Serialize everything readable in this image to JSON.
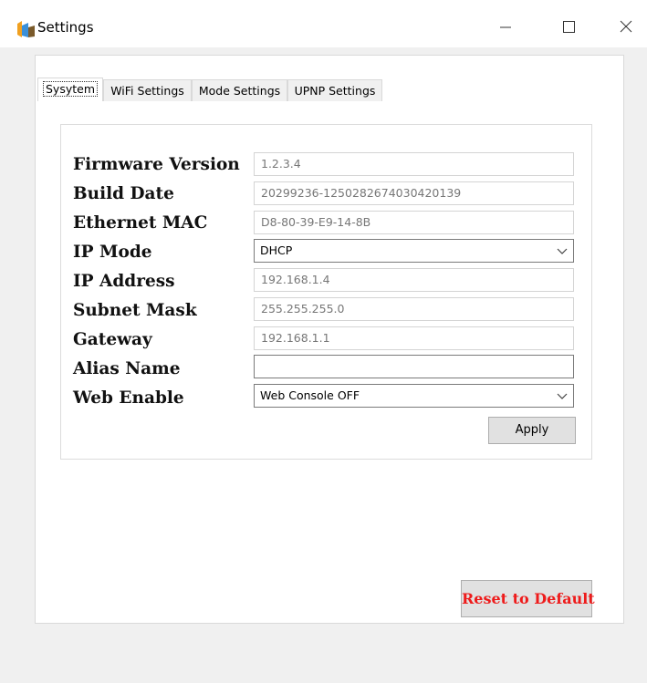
{
  "window": {
    "title": "Settings",
    "app_icon": "settings-app-icon",
    "controls": [
      "minimize-icon",
      "maximize-icon",
      "close-icon"
    ]
  },
  "tabs": [
    {
      "label": "Sysytem",
      "active": true
    },
    {
      "label": "WiFi Settings",
      "active": false
    },
    {
      "label": "Mode Settings",
      "active": false
    },
    {
      "label": "UPNP Settings",
      "active": false
    }
  ],
  "system": {
    "firmware_version": {
      "label": "Firmware Version",
      "value": "1.2.3.4"
    },
    "build_date": {
      "label": "Build Date",
      "value": "20299236-1250282674030420139"
    },
    "ethernet_mac": {
      "label": "Ethernet MAC",
      "value": "D8-80-39-E9-14-8B"
    },
    "ip_mode": {
      "label": "IP Mode",
      "value": "DHCP"
    },
    "ip_address": {
      "label": "IP Address",
      "value": "192.168.1.4"
    },
    "subnet_mask": {
      "label": "Subnet Mask",
      "value": "255.255.255.0"
    },
    "gateway": {
      "label": "Gateway",
      "value": "192.168.1.1"
    },
    "alias_name": {
      "label": "Alias Name",
      "value": ""
    },
    "web_enable": {
      "label": "Web Enable",
      "value": "Web Console OFF"
    },
    "apply_label": "Apply"
  },
  "reset_label": "Reset to Default",
  "colors": {
    "reset_text": "#ee1b1b",
    "button_bg": "#e1e1e1"
  }
}
